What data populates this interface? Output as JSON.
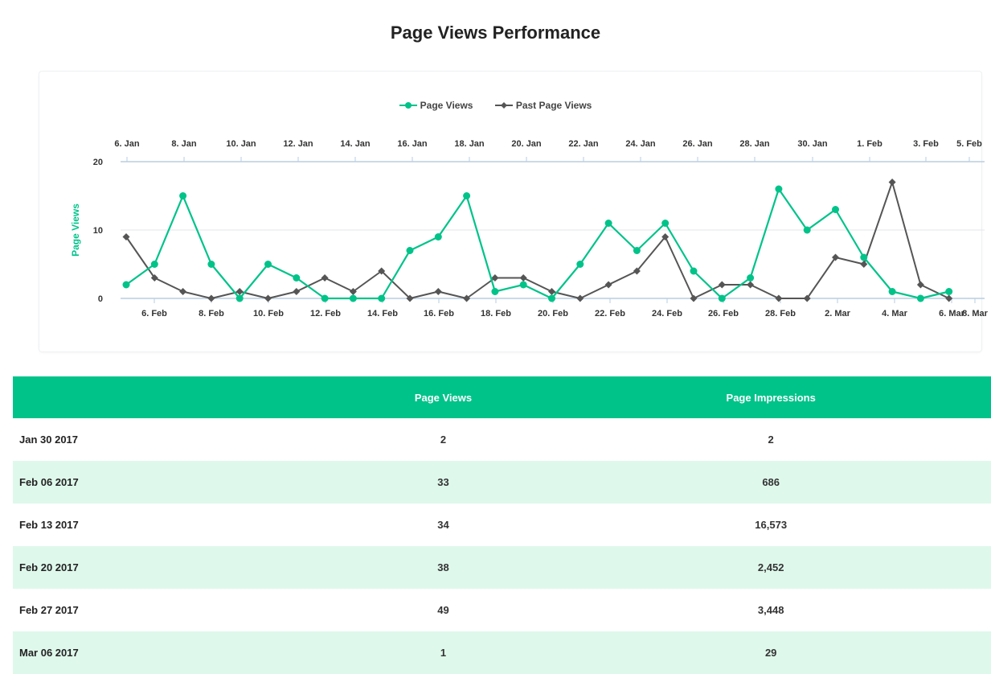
{
  "title": "Page Views Performance",
  "colors": {
    "current": "#00c389",
    "past": "#555555",
    "header_bg": "#00c389",
    "row_alt": "#dff8ec"
  },
  "chart_data": {
    "type": "line",
    "title": "Page Views Performance",
    "ylabel": "Page Views",
    "ylim": [
      0,
      20
    ],
    "yticks": [
      0,
      10,
      20
    ],
    "legend": "top-center",
    "grid": true,
    "x_bottom_ticks": [
      "6. Feb",
      "8. Feb",
      "10. Feb",
      "12. Feb",
      "14. Feb",
      "16. Feb",
      "18. Feb",
      "20. Feb",
      "22. Feb",
      "24. Feb",
      "26. Feb",
      "28. Feb",
      "2. Mar",
      "4. Mar",
      "6. Mar",
      "8. Mar"
    ],
    "x_top_ticks": [
      "6. Jan",
      "8. Jan",
      "10. Jan",
      "12. Jan",
      "14. Jan",
      "16. Jan",
      "18. Jan",
      "20. Jan",
      "22. Jan",
      "24. Jan",
      "26. Jan",
      "28. Jan",
      "30. Jan",
      "1. Feb",
      "3. Feb",
      "5. Feb"
    ],
    "series": [
      {
        "name": "Page Views",
        "x_start": "4. Feb",
        "values": [
          2,
          5,
          15,
          5,
          0,
          5,
          3,
          0,
          0,
          0,
          7,
          9,
          15,
          1,
          2,
          0,
          5,
          11,
          7,
          11,
          4,
          0,
          3,
          16,
          10,
          13,
          6,
          1,
          0,
          1
        ]
      },
      {
        "name": "Past Page Views",
        "x_start": "4. Jan",
        "values": [
          9,
          3,
          1,
          0,
          1,
          0,
          1,
          3,
          1,
          4,
          0,
          1,
          0,
          3,
          3,
          1,
          0,
          2,
          4,
          9,
          0,
          2,
          2,
          0,
          0,
          6,
          5,
          17,
          2,
          0
        ]
      }
    ]
  },
  "table": {
    "headers": [
      "",
      "Page Views",
      "Page Impressions"
    ],
    "rows": [
      [
        "Jan 30 2017",
        "2",
        "2"
      ],
      [
        "Feb 06 2017",
        "33",
        "686"
      ],
      [
        "Feb 13 2017",
        "34",
        "16,573"
      ],
      [
        "Feb 20 2017",
        "38",
        "2,452"
      ],
      [
        "Feb 27 2017",
        "49",
        "3,448"
      ],
      [
        "Mar 06 2017",
        "1",
        "29"
      ]
    ]
  }
}
